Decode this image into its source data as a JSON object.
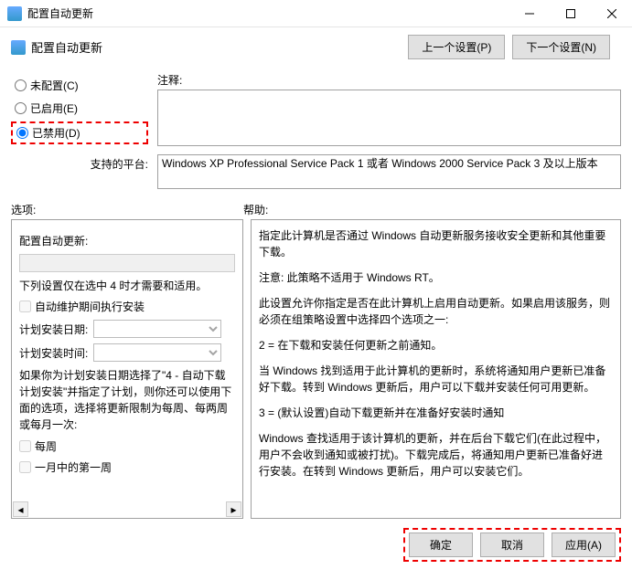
{
  "window": {
    "title": "配置自动更新"
  },
  "header": {
    "title": "配置自动更新",
    "prev": "上一个设置(P)",
    "next": "下一个设置(N)"
  },
  "radios": {
    "notconfigured": "未配置(C)",
    "enabled": "已启用(E)",
    "disabled": "已禁用(D)"
  },
  "comments_label": "注释:",
  "platforms_label": "支持的平台:",
  "platforms_text": "Windows XP Professional Service Pack 1 或者 Windows 2000 Service Pack 3 及以上版本",
  "options_label": "选项:",
  "help_label": "帮助:",
  "options": {
    "heading": "配置自动更新:",
    "note": "下列设置仅在选中 4 时才需要和适用。",
    "cb_maint": "自动维护期间执行安装",
    "sched_day": "计划安装日期:",
    "sched_time": "计划安装时间:",
    "long": "如果你为计划安装日期选择了\"4 - 自动下载计划安装\"并指定了计划，则你还可以使用下面的选项，选择将更新限制为每周、每两周或每月一次:",
    "cb_weekly": "每周",
    "cb_first": "一月中的第一周"
  },
  "help": {
    "p1": "指定此计算机是否通过 Windows 自动更新服务接收安全更新和其他重要下载。",
    "p2": "注意: 此策略不适用于 Windows RT。",
    "p3": "此设置允许你指定是否在此计算机上启用自动更新。如果启用该服务，则必须在组策略设置中选择四个选项之一:",
    "p4": "2 = 在下载和安装任何更新之前通知。",
    "p5": "当 Windows 找到适用于此计算机的更新时，系统将通知用户更新已准备好下载。转到 Windows 更新后，用户可以下载并安装任何可用更新。",
    "p6": "3 = (默认设置)自动下载更新并在准备好安装时通知",
    "p7": "Windows 查找适用于该计算机的更新，并在后台下载它们(在此过程中，用户不会收到通知或被打扰)。下载完成后，将通知用户更新已准备好进行安装。在转到 Windows 更新后，用户可以安装它们。"
  },
  "footer": {
    "ok": "确定",
    "cancel": "取消",
    "apply": "应用(A)"
  }
}
